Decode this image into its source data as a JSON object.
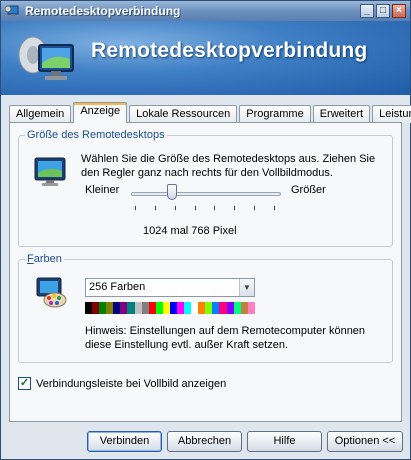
{
  "window": {
    "title": "Remotedesktopverbindung"
  },
  "banner": {
    "title": "Remotedesktopverbindung"
  },
  "tabs": [
    {
      "label": "Allgemein"
    },
    {
      "label": "Anzeige"
    },
    {
      "label": "Lokale Ressourcen"
    },
    {
      "label": "Programme"
    },
    {
      "label": "Erweitert"
    },
    {
      "label": "Leistung"
    }
  ],
  "size_group": {
    "legend_pre": "Größe des Remotedesktops",
    "description": "Wählen Sie die Größe des Remotedesktops aus. Ziehen Sie den Regler ganz nach rechts für den Vollbildmodus.",
    "slider_min_label": "Kleiner",
    "slider_max_label": "Größer",
    "slider_value_fraction": 0.27,
    "resolution_text": "1024 mal 768 Pixel"
  },
  "colors_group": {
    "legend_first": "F",
    "legend_rest": "arben",
    "selected_depth": "256 Farben",
    "hint": "Hinweis: Einstellungen auf dem Remotecomputer können diese Einstellung evtl. außer Kraft setzen."
  },
  "checkbox": {
    "label": "Verbindungsleiste bei Vollbild anzeigen",
    "checked": true
  },
  "buttons": {
    "connect": "Verbinden",
    "cancel": "Abbrechen",
    "help": "Hilfe",
    "options": "Optionen <<"
  },
  "colors": {
    "banner": "#3f7fc4",
    "legend": "#1d4d96",
    "active_tab_accent": "#f5b84a"
  }
}
